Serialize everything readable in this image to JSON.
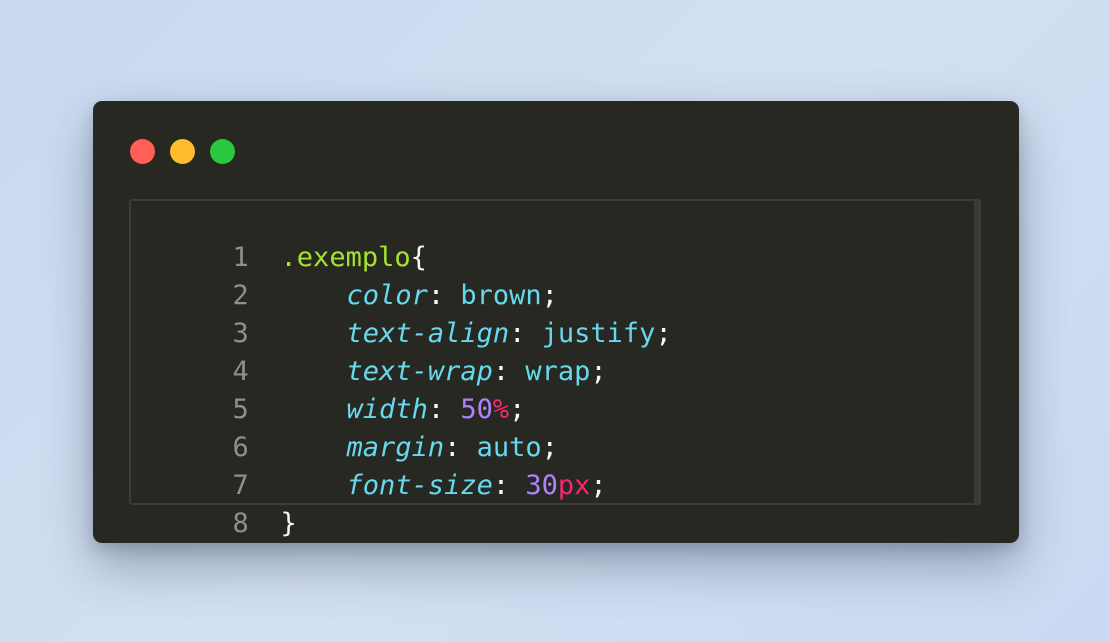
{
  "window": {
    "controls": [
      "close",
      "minimize",
      "maximize"
    ],
    "colors": {
      "close": "#ff5f57",
      "minimize": "#febc2e",
      "maximize": "#28c840",
      "background": "#282823"
    }
  },
  "code": {
    "line_numbers": [
      "1",
      "2",
      "3",
      "4",
      "5",
      "6",
      "7",
      "8"
    ],
    "selector": ".exemplo",
    "open_brace": "{",
    "close_brace": "}",
    "colon": ":",
    "semicolon": ";",
    "declarations": [
      {
        "property": "color",
        "value": "brown",
        "number": "",
        "unit": ""
      },
      {
        "property": "text-align",
        "value": "justify",
        "number": "",
        "unit": ""
      },
      {
        "property": "text-wrap",
        "value": "wrap",
        "number": "",
        "unit": ""
      },
      {
        "property": "width",
        "value": "",
        "number": "50",
        "unit": "%"
      },
      {
        "property": "margin",
        "value": "auto",
        "number": "",
        "unit": ""
      },
      {
        "property": "font-size",
        "value": "",
        "number": "30",
        "unit": "px"
      }
    ],
    "syntax_colors": {
      "selector": "#a6e22e",
      "property": "#66d9ef",
      "number": "#ae81ff",
      "unit": "#f92672",
      "punctuation": "#f8f8f2"
    }
  }
}
